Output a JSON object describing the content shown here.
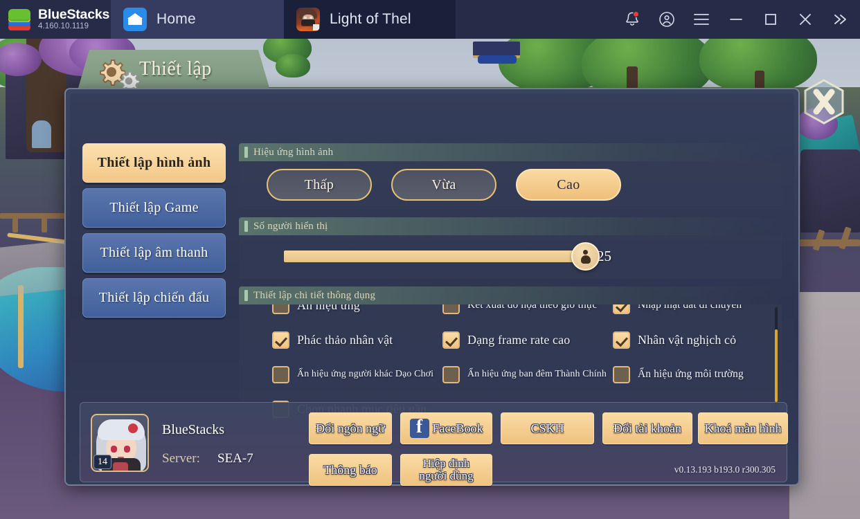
{
  "topbar": {
    "brand_name": "BlueStacks",
    "brand_version": "4.160.10.1119",
    "tabs": [
      {
        "label": "Home",
        "icon": "home-icon",
        "active": false
      },
      {
        "label": "Light of Thel",
        "icon": "game-avatar-icon",
        "active": true
      }
    ],
    "actions": [
      {
        "name": "notifications-button",
        "icon": "bell-icon",
        "badge": true
      },
      {
        "name": "account-button",
        "icon": "user-circle-icon"
      },
      {
        "name": "menu-button",
        "icon": "hamburger-icon"
      },
      {
        "name": "minimize-button",
        "icon": "minimize-icon"
      },
      {
        "name": "maximize-button",
        "icon": "maximize-icon"
      },
      {
        "name": "close-button",
        "icon": "close-icon"
      },
      {
        "name": "expand-sidebar-button",
        "icon": "chevron-double-right-icon"
      }
    ]
  },
  "dialog": {
    "title": "Thiết lập",
    "close_label": "",
    "side_tabs": [
      {
        "label": "Thiết lập hình ảnh",
        "active": true
      },
      {
        "label": "Thiết lập Game",
        "active": false
      },
      {
        "label": "Thiết lập âm thanh",
        "active": false
      },
      {
        "label": "Thiết lập chiến đấu",
        "active": false
      }
    ],
    "sections": {
      "graphics_effects": {
        "title": "Hiệu ứng hình ảnh",
        "options": [
          {
            "label": "Thấp",
            "selected": false
          },
          {
            "label": "Vừa",
            "selected": false
          },
          {
            "label": "Cao",
            "selected": true
          }
        ]
      },
      "player_count": {
        "title": "Số người hiển thị",
        "value": "25",
        "fill_percent": 97
      },
      "detail_settings": {
        "title": "Thiết lập chi tiết thông dụng",
        "rows": [
          [
            {
              "label": "Ẩn hiệu ứng",
              "checked": false,
              "size": "sz-lg"
            },
            {
              "label": "Kết xuất đồ họa theo giờ thực",
              "checked": false,
              "size": "sz-md"
            },
            {
              "label": "Nhập mặt đất di chuyển",
              "checked": true,
              "size": "sz-md"
            }
          ],
          [
            {
              "label": "Phác thảo nhân vật",
              "checked": true,
              "size": "sz-lg"
            },
            {
              "label": "Dạng frame rate cao",
              "checked": true,
              "size": "sz-lg"
            },
            {
              "label": "Nhân vật nghịch cỏ",
              "checked": true,
              "size": "sz-lg"
            }
          ],
          [
            {
              "label": "Ẩn hiệu ứng người khác Dạo Chơi",
              "checked": false,
              "size": "sz-sm"
            },
            {
              "label": "Ẩn hiệu ứng ban đêm Thành Chính",
              "checked": false,
              "size": "sz-sm"
            },
            {
              "label": "Ẩn hiệu ứng môi trường",
              "checked": false,
              "size": "sz-md"
            }
          ],
          [
            {
              "label": "Chọn nhanh mục tiêu gần",
              "checked": false,
              "size": "sz-lg"
            }
          ]
        ]
      }
    },
    "footer": {
      "player_name": "BlueStacks",
      "player_level": "14",
      "server_label": "Server:",
      "server_value": "SEA-7",
      "buttons": [
        {
          "label": "Đổi ngôn ngữ",
          "icon": null
        },
        {
          "label": "FaceBook",
          "icon": "facebook-icon"
        },
        {
          "label": "CSKH",
          "icon": null
        },
        {
          "label": "Đổi tài khoản",
          "icon": null
        },
        {
          "label": "Khoá màn hình",
          "icon": null
        },
        {
          "label": "Thông báo",
          "icon": null
        },
        {
          "label": "Hiệp định\nngười dùng",
          "icon": null
        }
      ],
      "version": "v0.13.193 b193.0 r300.305"
    }
  },
  "colors": {
    "topbar_bg": "#262b48",
    "tab_active_bg": "#1b203a",
    "tab_home_bg": "#363c60",
    "accent_gold": "#f0c384",
    "panel_bg": "#2f3550",
    "side_tab_blue": "#4f6ca6",
    "scrollbar": "#d9a72f",
    "notification_dot": "#ef3b33"
  }
}
